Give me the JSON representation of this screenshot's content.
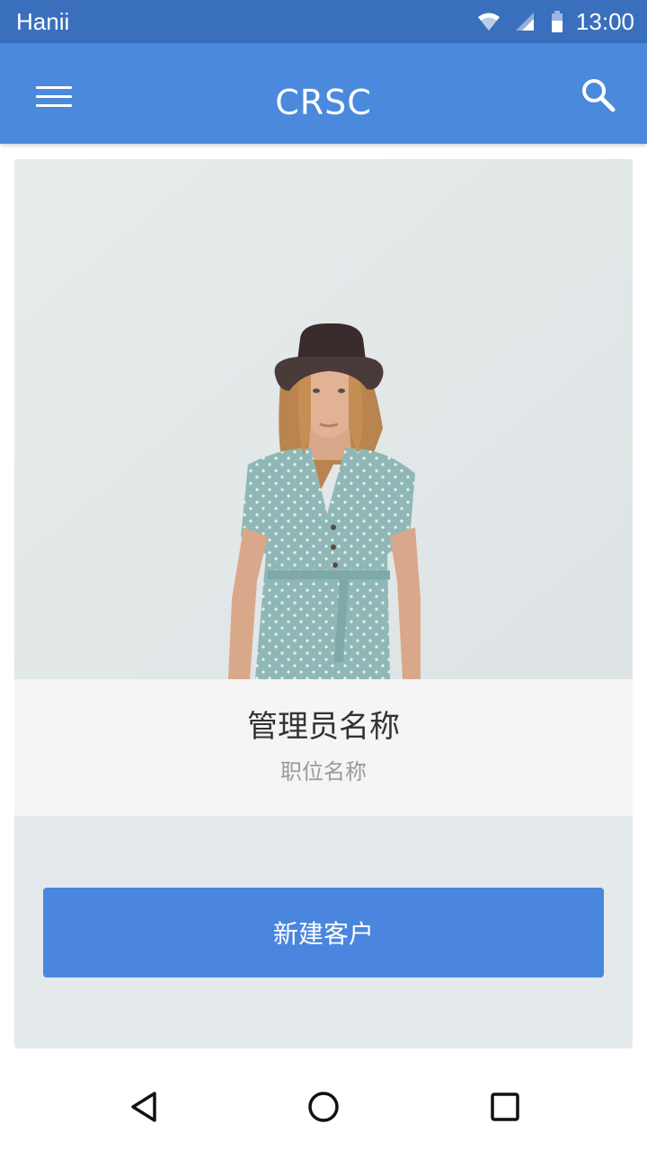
{
  "status_bar": {
    "carrier": "Hanii",
    "time": "13:00",
    "icons": [
      "wifi-icon",
      "cell-signal-icon",
      "battery-icon"
    ]
  },
  "app_bar": {
    "title": "CRSC",
    "menu_icon": "menu-icon",
    "search_icon": "search-icon"
  },
  "profile": {
    "photo": "profile-photo",
    "name": "管理员名称",
    "job_title": "职位名称"
  },
  "actions": {
    "new_customer_label": "新建客户"
  },
  "nav_bar": {
    "items": [
      "back-icon",
      "home-icon",
      "recents-icon"
    ]
  },
  "colors": {
    "status_bar": "#3a6fbe",
    "app_bar": "#4a89dc",
    "button": "#4a86de",
    "card_bg": "#e4e9eb",
    "name_panel": "#f5f5f5"
  }
}
